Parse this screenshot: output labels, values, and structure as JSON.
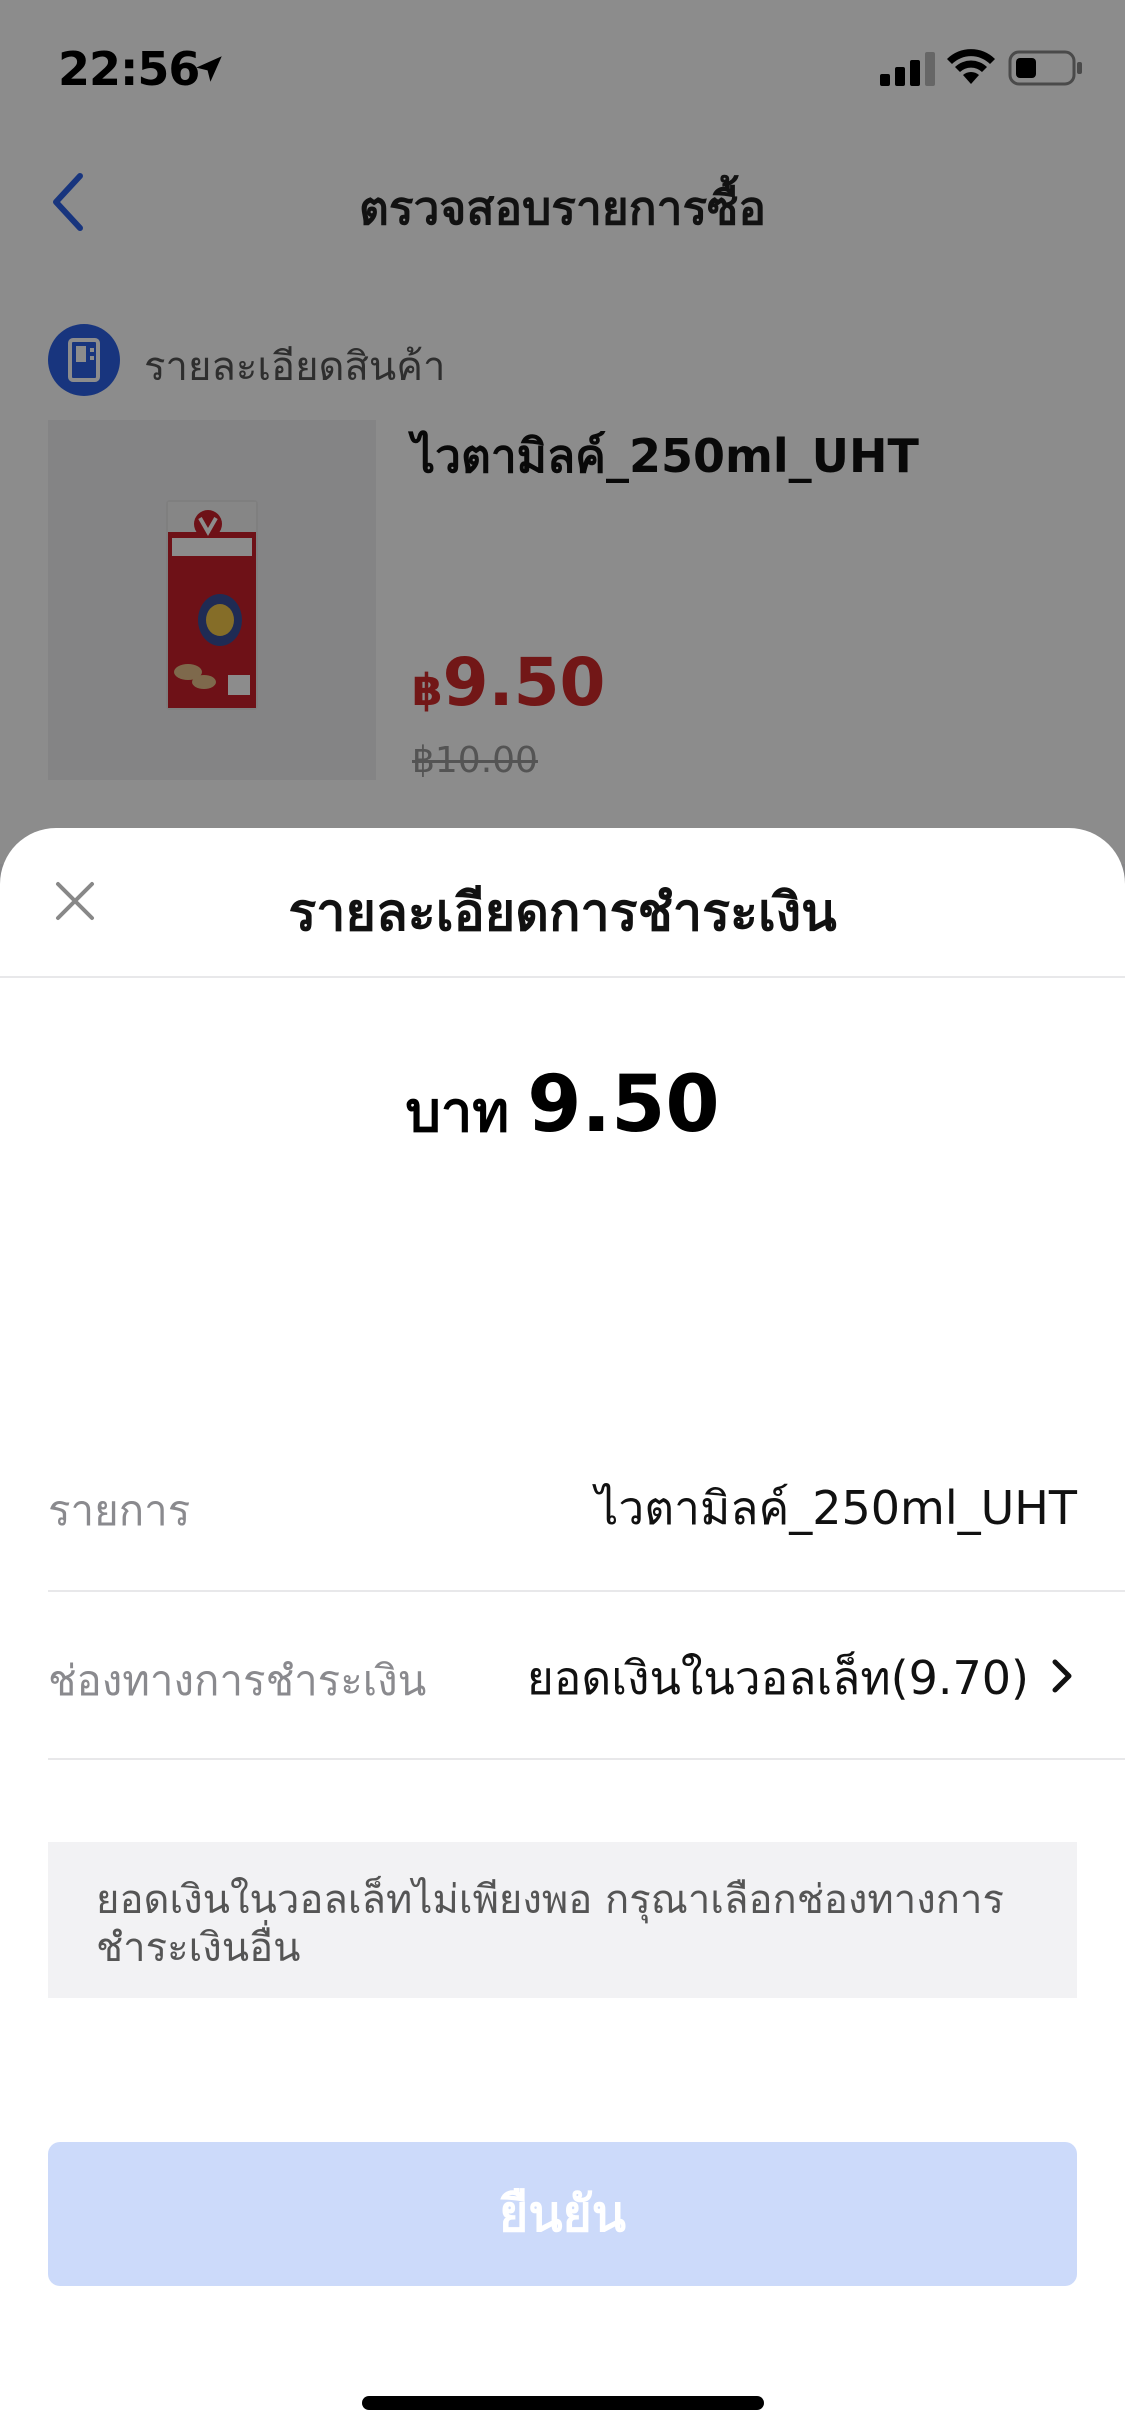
{
  "status_bar": {
    "time": "22:56"
  },
  "nav": {
    "title": "ตรวจสอบรายการซื้อ"
  },
  "product": {
    "section_label": "รายละเอียดสินค้า",
    "name": "ไวตามิลค์_250ml_UHT",
    "price_currency": "฿",
    "price": "9.50",
    "original_price": "฿10.00"
  },
  "sheet": {
    "title": "รายละเอียดการชำระเงิน",
    "amount_currency": "บาท",
    "amount": "9.50",
    "item_label": "รายการ",
    "item_value": "ไวตามิลค์_250ml_UHT",
    "payment_label": "ช่องทางการชำระเงิน",
    "payment_value": "ยอดเงินในวอลเล็ท(9.70)",
    "notice": "ยอดเงินในวอลเล็ทไม่เพียงพอ กรุณาเลือกช่องทางการชำระเงินอื่น",
    "confirm_label": "ยืนยัน"
  },
  "colors": {
    "accent": "#2d62e6",
    "price": "#d02a2a",
    "button_disabled": "#ccdafa"
  }
}
